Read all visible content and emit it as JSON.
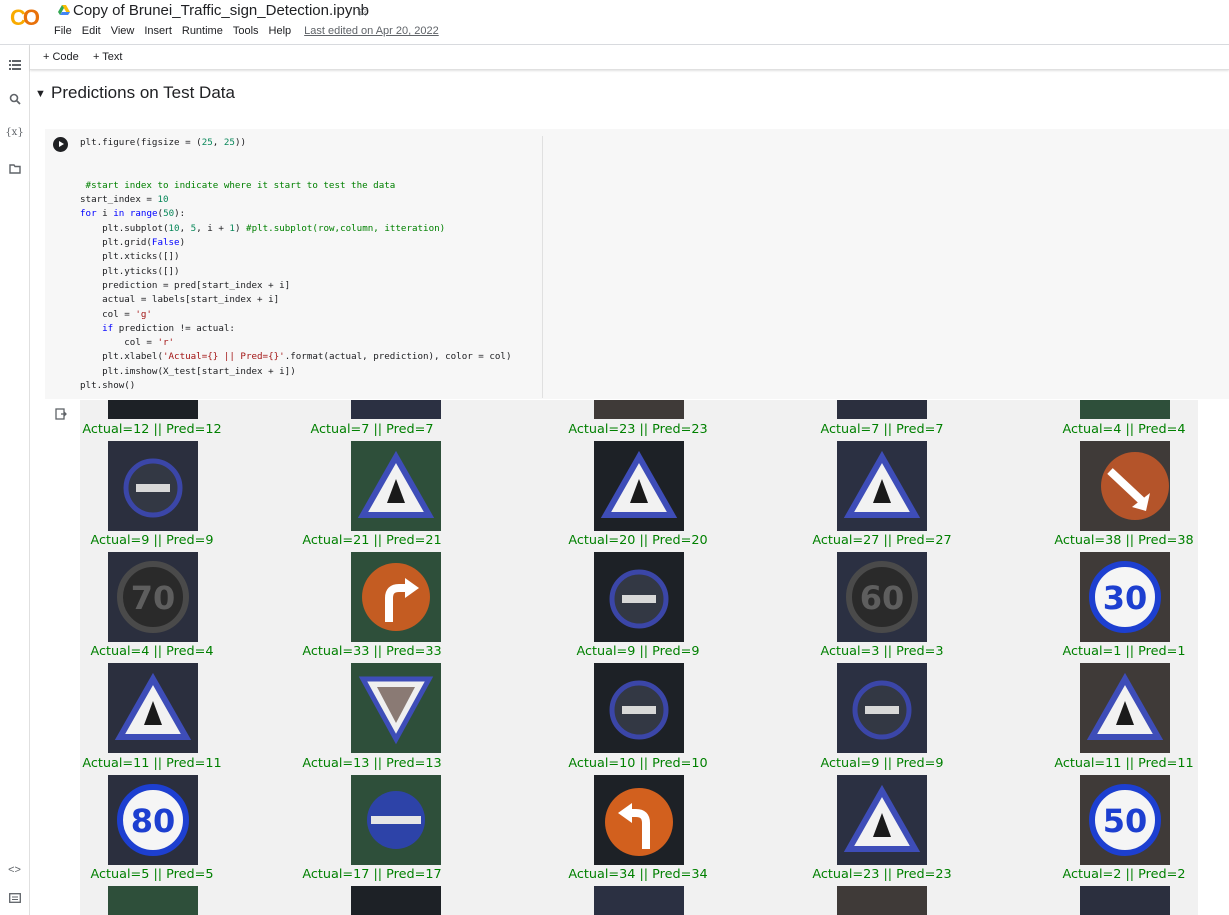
{
  "app": {
    "logo": "CO",
    "title": "Copy of Brunei_Traffic_sign_Detection.ipynb",
    "menu": [
      "File",
      "Edit",
      "View",
      "Insert",
      "Runtime",
      "Tools",
      "Help"
    ],
    "last_edited": "Last edited on Apr 20, 2022"
  },
  "toolbar": {
    "code_label": "+ Code",
    "text_label": "+ Text"
  },
  "rail": [
    "toc-icon",
    "search-icon",
    "variables-icon",
    "folder-icon",
    "code-snippets-icon",
    "terminal-icon"
  ],
  "section": {
    "title": "Predictions on Test Data"
  },
  "cell": {
    "code_lines": [
      "plt.figure(figsize = (25, 25))",
      "",
      "",
      " #start index to indicate where it start to test the data",
      "start_index = 10",
      "for i in range(50):",
      "    plt.subplot(10, 5, i + 1) #plt.subplot(row,column, itteration)",
      "    plt.grid(False)",
      "    plt.xticks([])",
      "    plt.yticks([])",
      "    prediction = pred[start_index + i]",
      "    actual = labels[start_index + i]",
      "    col = 'g'",
      "    if prediction != actual:",
      "        col = 'r'",
      "    plt.xlabel('Actual={} || Pred={}'.format(actual, prediction), color = col)",
      "    plt.imshow(X_test[start_index + i])",
      "plt.show()"
    ]
  },
  "output": {
    "label_color": "#008000",
    "rows": [
      [
        {
          "label": "Actual=12 || Pred=12",
          "sign": "none"
        },
        {
          "label": "Actual=7 || Pred=7",
          "sign": "none"
        },
        {
          "label": "Actual=23 || Pred=23",
          "sign": "none"
        },
        {
          "label": "Actual=7 || Pred=7",
          "sign": "none"
        },
        {
          "label": "Actual=4 || Pred=4",
          "sign": "none"
        }
      ],
      [
        {
          "label": "Actual=9 || Pred=9",
          "sign": "no-entry"
        },
        {
          "label": "Actual=21 || Pred=21",
          "sign": "warning-triangle"
        },
        {
          "label": "Actual=20 || Pred=20",
          "sign": "warning-triangle"
        },
        {
          "label": "Actual=27 || Pred=27",
          "sign": "warning-triangle"
        },
        {
          "label": "Actual=38 || Pred=38",
          "sign": "arrow-circle-orange"
        }
      ],
      [
        {
          "label": "Actual=4 || Pred=4",
          "sign": "speed-limit",
          "text": "70"
        },
        {
          "label": "Actual=33 || Pred=33",
          "sign": "turn-right-orange"
        },
        {
          "label": "Actual=9 || Pred=9",
          "sign": "no-entry"
        },
        {
          "label": "Actual=3 || Pred=3",
          "sign": "speed-limit",
          "text": "60"
        },
        {
          "label": "Actual=1 || Pred=1",
          "sign": "speed-limit",
          "text": "30"
        }
      ],
      [
        {
          "label": "Actual=11 || Pred=11",
          "sign": "warning-triangle"
        },
        {
          "label": "Actual=13 || Pred=13",
          "sign": "yield-triangle"
        },
        {
          "label": "Actual=10 || Pred=10",
          "sign": "no-entry"
        },
        {
          "label": "Actual=9 || Pred=9",
          "sign": "no-entry"
        },
        {
          "label": "Actual=11 || Pred=11",
          "sign": "warning-triangle"
        }
      ],
      [
        {
          "label": "Actual=5 || Pred=5",
          "sign": "speed-limit",
          "text": "80"
        },
        {
          "label": "Actual=17 || Pred=17",
          "sign": "no-entry-blue"
        },
        {
          "label": "Actual=34 || Pred=34",
          "sign": "turn-left-orange"
        },
        {
          "label": "Actual=23 || Pred=23",
          "sign": "warning-triangle"
        },
        {
          "label": "Actual=2 || Pred=2",
          "sign": "speed-limit",
          "text": "50"
        }
      ]
    ]
  }
}
